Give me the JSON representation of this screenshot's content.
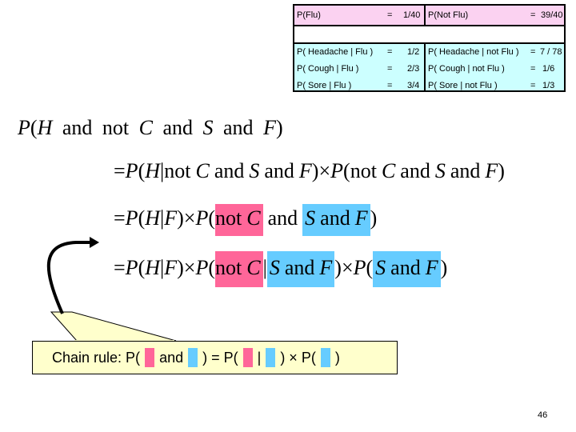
{
  "table": {
    "prior_row": {
      "left_label": "P(Flu)",
      "left_eq": "=",
      "left_value": "1/40",
      "right_label": "P(Not Flu)",
      "right_eq": "=",
      "right_value": "39/40"
    },
    "rows": [
      {
        "left_label": "P( Headache | Flu )",
        "left_eq": "=",
        "left_value": "1/2",
        "right_label": "P( Headache | not Flu )",
        "right_eq": "=",
        "right_value": "7 / 78"
      },
      {
        "left_label": "P( Cough | Flu )",
        "left_eq": "=",
        "left_value": "2/3",
        "right_label": "P( Cough | not Flu )",
        "right_eq": "=",
        "right_value": "1/6"
      },
      {
        "left_label": "P( Sore | Flu )",
        "left_eq": "=",
        "left_value": "3/4",
        "right_label": "P( Sore | not Flu )",
        "right_eq": "=",
        "right_value": "1/3"
      }
    ],
    "colors": {
      "prior_bg": "#fbd2f1",
      "cond_bg": "#ccffff"
    }
  },
  "equations": {
    "line1": {
      "p": "P",
      "open": "(",
      "H": "H",
      "and1": "and",
      "not": "not",
      "C": "C",
      "and2": "and",
      "S": "S",
      "and3": "and",
      "F": "F",
      "close": ")"
    },
    "line2": {
      "eq": "=",
      "p1": "P",
      "open1": "(",
      "H": "H",
      "bar": "|",
      "not": "not",
      "C": "C",
      "and1": "and",
      "S": "S",
      "and2": "and",
      "F": "F",
      "close1": ")",
      "times": "×",
      "p2": "P",
      "open2": "(",
      "not2": "not",
      "C2": "C",
      "and3": "and",
      "S2": "S",
      "and4": "and",
      "F2": "F",
      "close2": ")"
    },
    "line3": {
      "eq": "=",
      "p1": "P",
      "open1": "(",
      "H": "H",
      "bar": "|",
      "F": "F",
      "close1": ")",
      "times": "×",
      "p2": "P",
      "open2": "(",
      "not": "not",
      "C": "C",
      "and1": "and",
      "S": "S",
      "and2": "and",
      "F2": "F",
      "close2": ")"
    },
    "line4": {
      "eq": "=",
      "p1": "P",
      "open1": "(",
      "H": "H",
      "bar": "|",
      "F": "F",
      "close1": ")",
      "times": "×",
      "p2": "P",
      "open2": "(",
      "not": "not",
      "C": "C",
      "bar2": "|",
      "S": "S",
      "and1": "and",
      "F2": "F",
      "close2": ")",
      "times2": "×",
      "p3": "P",
      "open3": "(",
      "S3": "S",
      "and2": "and",
      "F3": "F",
      "close3": ")"
    },
    "colors": {
      "pink_highlight": "#ff6699",
      "blue_highlight": "#66ccff"
    }
  },
  "callout": {
    "prefix": "Chain rule: P(",
    "and": "and",
    "mid": ") = P(",
    "bar": "|",
    "times": ") × P(",
    "end": ")",
    "bg": "#ffffcc"
  },
  "arrow": {
    "icon": "curved-arrow-icon"
  },
  "page_number": "46"
}
